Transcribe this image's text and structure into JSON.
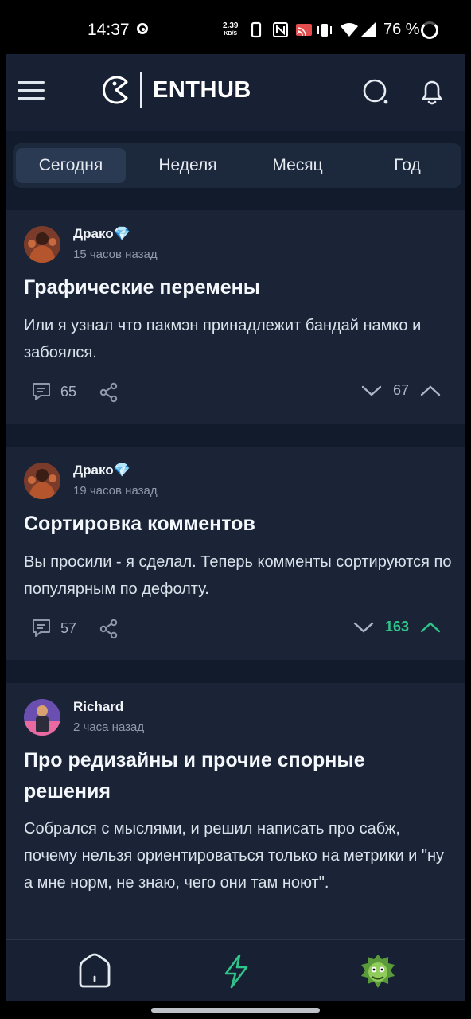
{
  "status_bar": {
    "time": "14:37",
    "net_rate_value": "2.39",
    "net_rate_unit": "KB/S",
    "battery": "76 %",
    "icons": [
      "record-icon",
      "phone-icon",
      "nfc-icon",
      "cast-icon",
      "vibrate-icon",
      "wifi-icon",
      "signal-icon",
      "battery-ring-icon"
    ]
  },
  "header": {
    "brand": "ENTHUB",
    "icons": [
      "menu-icon",
      "logo-pacman-icon",
      "search-icon",
      "bell-icon"
    ]
  },
  "tabs": [
    {
      "label": "Сегодня",
      "active": true
    },
    {
      "label": "Неделя",
      "active": false
    },
    {
      "label": "Месяц",
      "active": false
    },
    {
      "label": "Год",
      "active": false
    }
  ],
  "posts": [
    {
      "author": "Драко💎",
      "time": "15 часов назад",
      "title": "Графические перемены",
      "body": "Или я узнал что пакмэн принадлежит бандай намко и забоялся.",
      "comments": "65",
      "score": "67",
      "upvoted": false
    },
    {
      "author": "Драко💎",
      "time": "19 часов назад",
      "title": "Сортировка комментов",
      "body": "Вы просили - я сделал. Теперь комменты сортируются по популярным по дефолту.",
      "comments": "57",
      "score": "163",
      "upvoted": true
    },
    {
      "author": "Richard",
      "time": "2 часа назад",
      "title": "Про редизайны и прочие спорные решения",
      "body": "Собрался с мыслями, и решил написать про сабж, почему нельзя ориентироваться только на метрики и \"ну а мне норм, не знаю, чего они там ноют\"."
    }
  ],
  "bottom_nav": [
    "home-icon",
    "lightning-icon",
    "profile-avatar"
  ],
  "colors": {
    "background": "#121b2b",
    "card": "#1a2436",
    "accent_green": "#2fc58a",
    "muted": "#8e9aac"
  }
}
